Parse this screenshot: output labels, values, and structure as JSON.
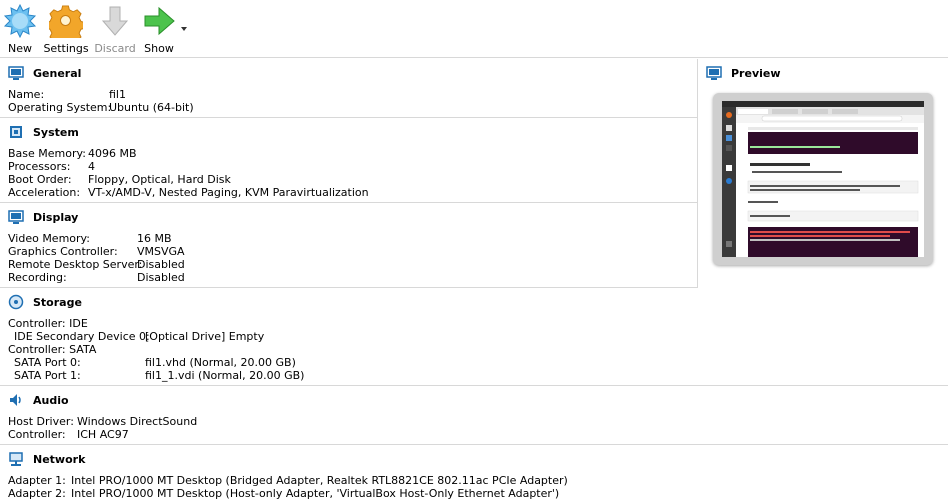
{
  "toolbar": {
    "new_label": "New",
    "settings_label": "Settings",
    "discard_label": "Discard",
    "show_label": "Show"
  },
  "general": {
    "title": "General",
    "name_key": "Name:",
    "name_value": "fil1",
    "os_key": "Operating System:",
    "os_value": "Ubuntu (64-bit)"
  },
  "system": {
    "title": "System",
    "rows": [
      {
        "key": "Base Memory:",
        "value": "4096 MB"
      },
      {
        "key": "Processors:",
        "value": "4"
      },
      {
        "key": "Boot Order:",
        "value": "Floppy, Optical, Hard Disk"
      },
      {
        "key": "Acceleration:",
        "value": "VT-x/AMD-V, Nested Paging, KVM Paravirtualization"
      }
    ]
  },
  "display": {
    "title": "Display",
    "rows": [
      {
        "key": "Video Memory:",
        "value": "16 MB"
      },
      {
        "key": "Graphics Controller:",
        "value": "VMSVGA"
      },
      {
        "key": "Remote Desktop Server:",
        "value": "Disabled"
      },
      {
        "key": "Recording:",
        "value": "Disabled"
      }
    ]
  },
  "storage": {
    "title": "Storage",
    "controller_ide": "Controller: IDE",
    "ide_secondary_key": "IDE Secondary Device 0:",
    "ide_secondary_value": "[Optical Drive] Empty",
    "controller_sata": "Controller: SATA",
    "sata0_key": "SATA Port 0:",
    "sata0_value": "fil1.vhd (Normal, 20.00 GB)",
    "sata1_key": "SATA Port 1:",
    "sata1_value": "fil1_1.vdi (Normal, 20.00 GB)"
  },
  "audio": {
    "title": "Audio",
    "host_driver_key": "Host Driver:",
    "host_driver_value": "Windows DirectSound",
    "controller_key": "Controller:",
    "controller_value": "ICH AC97"
  },
  "network": {
    "title": "Network",
    "adapter1_key": "Adapter 1:",
    "adapter1_value": "Intel PRO/1000 MT Desktop (Bridged Adapter, Realtek RTL8821CE 802.11ac PCIe Adapter)",
    "adapter2_key": "Adapter 2:",
    "adapter2_value": "Intel PRO/1000 MT Desktop (Host-only Adapter, 'VirtualBox Host-Only Ethernet Adapter')"
  },
  "preview": {
    "title": "Preview"
  },
  "colors": {
    "accent_blue": "#1f6fb2",
    "new_icon": "#5aaee8",
    "settings_icon": "#f0a020",
    "show_icon": "#3fb83f",
    "discard_icon": "#c8c8c8"
  },
  "icons": [
    "new-icon",
    "settings-icon",
    "discard-icon",
    "show-icon",
    "general-icon",
    "system-icon",
    "display-icon",
    "storage-icon",
    "audio-icon",
    "network-icon",
    "preview-icon"
  ]
}
